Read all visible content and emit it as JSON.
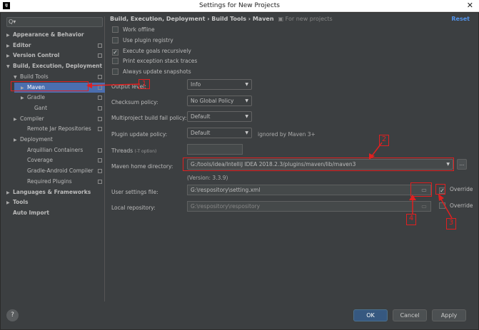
{
  "window": {
    "title": "Settings for New Projects",
    "app_icon": "IJ",
    "close_glyph": "✕"
  },
  "search": {
    "icon": "Q▾",
    "value": ""
  },
  "sidebar": {
    "items": [
      {
        "label": "Appearance & Behavior",
        "tri": "▶",
        "proj": false
      },
      {
        "label": "Editor",
        "tri": "▶",
        "proj": true
      },
      {
        "label": "Version Control",
        "tri": "▶",
        "proj": true
      },
      {
        "label": "Build, Execution, Deployment",
        "tri": "▼",
        "proj": false
      },
      {
        "label": "Build Tools",
        "tri": "▼",
        "proj": true
      },
      {
        "label": "Maven",
        "tri": "▶",
        "proj": true
      },
      {
        "label": "Gradle",
        "tri": "▶",
        "proj": true
      },
      {
        "label": "Gant",
        "tri": "",
        "proj": true
      },
      {
        "label": "Compiler",
        "tri": "▶",
        "proj": true
      },
      {
        "label": "Remote Jar Repositories",
        "tri": "",
        "proj": true
      },
      {
        "label": "Deployment",
        "tri": "▶",
        "proj": false
      },
      {
        "label": "Arquillian Containers",
        "tri": "",
        "proj": true
      },
      {
        "label": "Coverage",
        "tri": "",
        "proj": true
      },
      {
        "label": "Gradle-Android Compiler",
        "tri": "",
        "proj": true
      },
      {
        "label": "Required Plugins",
        "tri": "",
        "proj": true
      },
      {
        "label": "Languages & Frameworks",
        "tri": "▶",
        "proj": false
      },
      {
        "label": "Tools",
        "tri": "▶",
        "proj": false
      },
      {
        "label": "Auto Import",
        "tri": "",
        "proj": false
      }
    ]
  },
  "breadcrumb": {
    "path": "Build, Execution, Deployment  ›  Build Tools  ›  Maven",
    "hint": "For new projects",
    "reset": "Reset"
  },
  "checkboxes": [
    {
      "label": "Work offline",
      "checked": false
    },
    {
      "label": "Use plugin registry",
      "checked": false
    },
    {
      "label": "Execute goals recursively",
      "checked": true
    },
    {
      "label": "Print exception stack traces",
      "checked": false
    },
    {
      "label": "Always update snapshots",
      "checked": false
    }
  ],
  "form": {
    "output_level": {
      "label": "Output level:",
      "value": "Info"
    },
    "checksum_policy": {
      "label": "Checksum policy:",
      "value": "No Global Policy"
    },
    "multiproject_policy": {
      "label": "Multiproject build fail policy:",
      "value": "Default"
    },
    "plugin_update_policy": {
      "label": "Plugin update policy:",
      "value": "Default",
      "note": "ignored by Maven 3+"
    },
    "threads": {
      "label": "Threads",
      "hint": "(-T option)",
      "value": ""
    },
    "maven_home": {
      "label": "Maven home directory:",
      "value": "G:/tools/idea/IntelliJ IDEA 2018.2.3/plugins/maven/lib/maven3",
      "version": "(Version: 3.3.9)",
      "more_button": "..."
    },
    "user_settings": {
      "label": "User settings file:",
      "value": "G:\\respository\\setting.xml",
      "override_label": "Override",
      "override_checked": true
    },
    "local_repository": {
      "label": "Local repository:",
      "value": "G:\\respository\\respository",
      "override_label": "Override",
      "override_checked": false
    }
  },
  "annotations": {
    "n1": "1",
    "n2": "2",
    "n3": "3",
    "n4": "4"
  },
  "footer": {
    "help": "?",
    "ok": "OK",
    "cancel": "Cancel",
    "apply": "Apply"
  },
  "colors": {
    "selection": "#4b6eaf",
    "annotation": "#e02020",
    "link": "#5394ec"
  }
}
